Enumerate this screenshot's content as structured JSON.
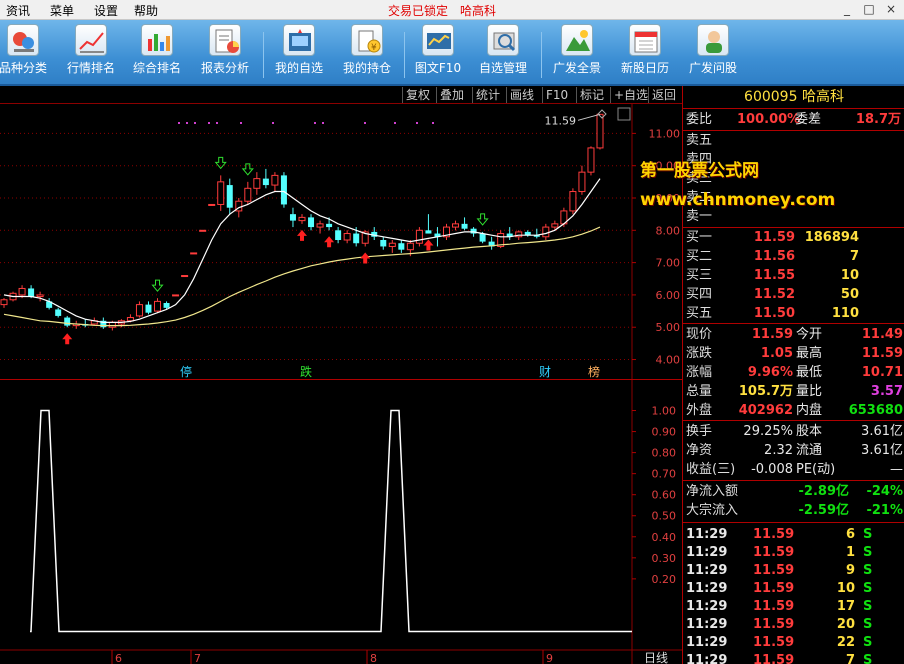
{
  "menu": {
    "items": [
      "资讯",
      "菜单",
      "设置",
      "帮助"
    ],
    "status": "交易已锁定　哈高科",
    "window_controls": [
      "_",
      "□",
      "×"
    ]
  },
  "toolbar": {
    "buttons": [
      {
        "label": "品种分类",
        "icon": "category-icon"
      },
      {
        "label": "行情排名",
        "icon": "ranking-icon"
      },
      {
        "label": "综合排名",
        "icon": "composite-ranking-icon"
      },
      {
        "label": "报表分析",
        "icon": "report-icon"
      },
      {
        "label": "我的自选",
        "icon": "watchlist-icon"
      },
      {
        "label": "我的持仓",
        "icon": "holdings-icon"
      },
      {
        "label": "图文F10",
        "icon": "f10-icon"
      },
      {
        "label": "自选管理",
        "icon": "watchlist-manage-icon"
      },
      {
        "label": "广发全景",
        "icon": "panorama-icon"
      },
      {
        "label": "新股日历",
        "icon": "ipo-calendar-icon"
      },
      {
        "label": "广发问股",
        "icon": "ask-stock-icon"
      }
    ]
  },
  "chart_tabs": [
    "复权",
    "叠加",
    "统计",
    "画线",
    "F10",
    "标记",
    "+自选",
    "返回"
  ],
  "chart_data": [
    {
      "type": "candlestick",
      "title": "",
      "price_axis": [
        11.0,
        10.0,
        9.0,
        8.0,
        7.0,
        6.0,
        5.0,
        4.0
      ],
      "ylim": [
        3.8,
        11.6
      ],
      "max_price_label": "11.59",
      "x_month_labels": [
        "6",
        "7",
        "8",
        "9"
      ],
      "bottom_labels": [
        "停",
        "跌",
        "财",
        "榜"
      ],
      "candles": [
        [
          5.7,
          5.9,
          5.6,
          5.85
        ],
        [
          5.85,
          6.1,
          5.8,
          6.05
        ],
        [
          6.0,
          6.3,
          5.9,
          6.2
        ],
        [
          6.2,
          6.3,
          5.9,
          5.95
        ],
        [
          5.95,
          6.1,
          5.8,
          6.0
        ],
        [
          5.8,
          5.9,
          5.55,
          5.6
        ],
        [
          5.55,
          5.6,
          5.3,
          5.35
        ],
        [
          5.3,
          5.35,
          5.0,
          5.05
        ],
        [
          5.05,
          5.2,
          4.95,
          5.1
        ],
        [
          5.1,
          5.25,
          5.0,
          5.05
        ],
        [
          5.1,
          5.3,
          5.05,
          5.2
        ],
        [
          5.2,
          5.3,
          4.95,
          5.0
        ],
        [
          5.0,
          5.2,
          4.9,
          5.15
        ],
        [
          5.1,
          5.25,
          5.0,
          5.2
        ],
        [
          5.2,
          5.4,
          5.15,
          5.3
        ],
        [
          5.35,
          5.8,
          5.3,
          5.7
        ],
        [
          5.7,
          5.8,
          5.4,
          5.45
        ],
        [
          5.5,
          5.9,
          5.45,
          5.8
        ],
        [
          5.75,
          5.8,
          5.55,
          5.6
        ],
        [
          6.0,
          6.0,
          6.0,
          6.0
        ],
        [
          6.6,
          6.6,
          6.6,
          6.6
        ],
        [
          7.3,
          7.3,
          7.3,
          7.3
        ],
        [
          8.0,
          8.0,
          8.0,
          8.0
        ],
        [
          8.8,
          8.8,
          8.8,
          8.8
        ],
        [
          8.8,
          9.7,
          8.6,
          9.5
        ],
        [
          9.4,
          9.6,
          8.5,
          8.7
        ],
        [
          8.6,
          9.0,
          8.4,
          8.9
        ],
        [
          8.9,
          9.5,
          8.8,
          9.3
        ],
        [
          9.3,
          9.8,
          9.1,
          9.6
        ],
        [
          9.6,
          9.9,
          9.3,
          9.4
        ],
        [
          9.4,
          9.8,
          9.2,
          9.7
        ],
        [
          9.7,
          9.8,
          8.7,
          8.8
        ],
        [
          8.5,
          8.7,
          8.1,
          8.3
        ],
        [
          8.3,
          8.5,
          8.2,
          8.4
        ],
        [
          8.4,
          8.5,
          8.0,
          8.1
        ],
        [
          8.1,
          8.3,
          7.9,
          8.2
        ],
        [
          8.2,
          8.4,
          8.0,
          8.1
        ],
        [
          8.0,
          8.1,
          7.6,
          7.7
        ],
        [
          7.7,
          8.0,
          7.6,
          7.9
        ],
        [
          7.9,
          8.1,
          7.5,
          7.6
        ],
        [
          7.6,
          8.0,
          7.5,
          7.95
        ],
        [
          7.95,
          8.1,
          7.7,
          7.8
        ],
        [
          7.7,
          7.8,
          7.4,
          7.5
        ],
        [
          7.5,
          7.7,
          7.3,
          7.6
        ],
        [
          7.6,
          7.7,
          7.3,
          7.4
        ],
        [
          7.4,
          7.7,
          7.2,
          7.6
        ],
        [
          7.6,
          8.1,
          7.5,
          8.0
        ],
        [
          8.0,
          8.5,
          7.9,
          7.9
        ],
        [
          7.9,
          8.1,
          7.5,
          7.8
        ],
        [
          7.8,
          8.2,
          7.7,
          8.1
        ],
        [
          8.1,
          8.3,
          8.0,
          8.2
        ],
        [
          8.2,
          8.4,
          8.0,
          8.05
        ],
        [
          8.05,
          8.1,
          7.8,
          7.9
        ],
        [
          7.9,
          7.95,
          7.6,
          7.65
        ],
        [
          7.65,
          7.8,
          7.4,
          7.5
        ],
        [
          7.5,
          8.0,
          7.45,
          7.9
        ],
        [
          7.9,
          8.1,
          7.7,
          7.8
        ],
        [
          7.8,
          8.0,
          7.7,
          7.95
        ],
        [
          7.95,
          8.0,
          7.8,
          7.85
        ],
        [
          7.85,
          8.05,
          7.75,
          7.8
        ],
        [
          7.8,
          8.2,
          7.7,
          8.1
        ],
        [
          8.1,
          8.3,
          8.0,
          8.2
        ],
        [
          8.2,
          8.7,
          8.1,
          8.6
        ],
        [
          8.6,
          9.3,
          8.5,
          9.2
        ],
        [
          9.2,
          10.0,
          9.1,
          9.8
        ],
        [
          9.8,
          10.6,
          9.7,
          10.55
        ],
        [
          10.55,
          11.59,
          10.5,
          11.59
        ]
      ],
      "ma_short": [
        6.0,
        5.95,
        5.95,
        5.95,
        5.9,
        5.8,
        5.65,
        5.5,
        5.35,
        5.25,
        5.2,
        5.15,
        5.15,
        5.15,
        5.18,
        5.25,
        5.35,
        5.45,
        5.55,
        5.7,
        6.0,
        6.5,
        7.1,
        7.7,
        8.2,
        8.5,
        8.7,
        8.8,
        8.95,
        9.1,
        9.2,
        9.2,
        9.0,
        8.8,
        8.6,
        8.45,
        8.35,
        8.2,
        8.1,
        8.0,
        7.9,
        7.85,
        7.8,
        7.75,
        7.7,
        7.65,
        7.7,
        7.75,
        7.8,
        7.85,
        7.9,
        7.95,
        7.95,
        7.9,
        7.85,
        7.8,
        7.8,
        7.85,
        7.85,
        7.85,
        7.9,
        8.0,
        8.2,
        8.45,
        8.8,
        9.2,
        9.6
      ],
      "ma_long": [
        5.4,
        5.35,
        5.3,
        5.25,
        5.2,
        5.18,
        5.15,
        5.12,
        5.1,
        5.08,
        5.06,
        5.05,
        5.05,
        5.05,
        5.06,
        5.08,
        5.1,
        5.13,
        5.17,
        5.22,
        5.3,
        5.4,
        5.52,
        5.65,
        5.8,
        5.95,
        6.08,
        6.2,
        6.32,
        6.43,
        6.55,
        6.65,
        6.74,
        6.82,
        6.9,
        6.96,
        7.02,
        7.07,
        7.11,
        7.15,
        7.18,
        7.2,
        7.22,
        7.24,
        7.26,
        7.28,
        7.3,
        7.33,
        7.36,
        7.39,
        7.42,
        7.45,
        7.48,
        7.5,
        7.52,
        7.55,
        7.57,
        7.6,
        7.62,
        7.64,
        7.67,
        7.7,
        7.74,
        7.8,
        7.88,
        7.98,
        8.1
      ]
    },
    {
      "type": "line",
      "title": "",
      "y_axis": [
        1.0,
        0.9,
        0.8,
        0.7,
        0.6,
        0.5,
        0.4,
        0.3,
        0.2
      ],
      "ylim": [
        -0.1,
        1.05
      ],
      "x_label": "日线",
      "values": [
        0,
        0,
        0,
        0,
        0,
        0,
        0,
        0,
        0,
        0,
        0,
        0,
        0,
        0,
        0,
        0,
        0,
        0,
        0,
        0,
        0,
        0,
        0,
        0,
        0,
        0,
        0,
        0,
        0,
        0,
        0,
        0,
        0,
        0,
        0,
        0,
        0,
        0,
        0,
        0,
        0,
        0,
        0,
        0,
        0,
        0,
        0,
        0,
        0,
        0,
        0,
        0,
        0,
        0,
        0,
        0,
        0,
        0,
        0,
        0,
        0,
        0,
        0,
        0,
        0,
        0,
        0
      ],
      "pulses": [
        [
          2,
          1.0
        ],
        [
          32,
          1.0
        ]
      ],
      "baseline": -0.05
    }
  ],
  "quote": {
    "code": "600095",
    "name": "哈高科",
    "wei_bi_label": "委比",
    "wei_bi": "100.00%",
    "wei_cha_label": "委差",
    "wei_cha": "18.7万",
    "sell": [
      {
        "label": "卖五",
        "price": "",
        "vol": ""
      },
      {
        "label": "卖四",
        "price": "",
        "vol": ""
      },
      {
        "label": "卖三",
        "price": "",
        "vol": ""
      },
      {
        "label": "卖二",
        "price": "",
        "vol": ""
      },
      {
        "label": "卖一",
        "price": "",
        "vol": ""
      }
    ],
    "buy": [
      {
        "label": "买一",
        "price": "11.59",
        "vol": "186894"
      },
      {
        "label": "买二",
        "price": "11.56",
        "vol": "7"
      },
      {
        "label": "买三",
        "price": "11.55",
        "vol": "10"
      },
      {
        "label": "买四",
        "price": "11.52",
        "vol": "50"
      },
      {
        "label": "买五",
        "price": "11.50",
        "vol": "110"
      }
    ],
    "stats": [
      {
        "l1": "现价",
        "v1": "11.59",
        "c1": "red",
        "l2": "今开",
        "v2": "11.49",
        "c2": "red"
      },
      {
        "l1": "涨跌",
        "v1": "1.05",
        "c1": "red",
        "l2": "最高",
        "v2": "11.59",
        "c2": "red"
      },
      {
        "l1": "涨幅",
        "v1": "9.96%",
        "c1": "red",
        "l2": "最低",
        "v2": "10.71",
        "c2": "red"
      },
      {
        "l1": "总量",
        "v1": "105.7万",
        "c1": "yellow",
        "l2": "量比",
        "v2": "3.57",
        "c2": "magenta"
      },
      {
        "l1": "外盘",
        "v1": "402962",
        "c1": "red",
        "l2": "内盘",
        "v2": "653680",
        "c2": "green"
      }
    ],
    "fundamentals": [
      {
        "l1": "换手",
        "v1": "29.25%",
        "l2": "股本",
        "v2": "3.61亿"
      },
      {
        "l1": "净资",
        "v1": "2.32",
        "l2": "流通",
        "v2": "3.61亿"
      },
      {
        "l1": "收益(三)",
        "v1": "-0.008",
        "l2": "PE(动)",
        "v2": "—"
      }
    ],
    "flows": [
      {
        "label": "净流入额",
        "value": "-2.89亿",
        "pct": "-24%"
      },
      {
        "label": "大宗流入",
        "value": "-2.59亿",
        "pct": "-21%"
      }
    ],
    "ticks": [
      {
        "time": "11:29",
        "price": "11.59",
        "vol": "6",
        "side": "S"
      },
      {
        "time": "11:29",
        "price": "11.59",
        "vol": "1",
        "side": "S"
      },
      {
        "time": "11:29",
        "price": "11.59",
        "vol": "9",
        "side": "S"
      },
      {
        "time": "11:29",
        "price": "11.59",
        "vol": "10",
        "side": "S"
      },
      {
        "time": "11:29",
        "price": "11.59",
        "vol": "17",
        "side": "S"
      },
      {
        "time": "11:29",
        "price": "11.59",
        "vol": "20",
        "side": "S"
      },
      {
        "time": "11:29",
        "price": "11.59",
        "vol": "22",
        "side": "S"
      },
      {
        "time": "11:29",
        "price": "11.59",
        "vol": "7",
        "side": "S"
      }
    ]
  },
  "watermark": {
    "line1": "第一股票公式网",
    "line2": "www.chnmoney.com"
  },
  "colors": {
    "up": "#ff3c3c",
    "down": "#54ffff",
    "grid": "#8b0000",
    "ma_short": "#ffffff",
    "ma_long": "#f0e68c",
    "toolbar": "#3d8fd4"
  }
}
